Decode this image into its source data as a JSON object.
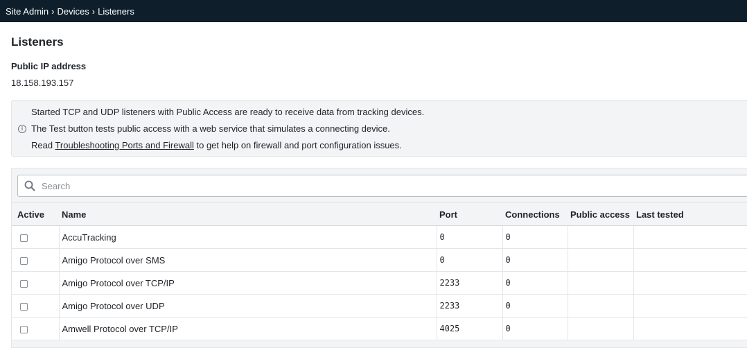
{
  "breadcrumb": {
    "items": [
      "Site Admin",
      "Devices",
      "Listeners"
    ],
    "separator": "›"
  },
  "page": {
    "title": "Listeners",
    "ip_label": "Public IP address",
    "ip_value": "18.158.193.157"
  },
  "info": {
    "line1": "Started TCP and UDP listeners with Public Access are ready to receive data from tracking devices.",
    "line2": "The Test button tests public access with a web service that simulates a connecting device.",
    "line3_prefix": "Read ",
    "line3_link": "Troubleshooting Ports and Firewall",
    "line3_suffix": " to get help on firewall and port configuration issues.",
    "icon": "info-circle-icon"
  },
  "search": {
    "placeholder": "Search",
    "value": "",
    "icon": "search-icon"
  },
  "table": {
    "headers": {
      "active": "Active",
      "name": "Name",
      "port": "Port",
      "connections": "Connections",
      "public_access": "Public access",
      "last_tested": "Last tested"
    },
    "rows": [
      {
        "active": false,
        "name": "AccuTracking",
        "port": "0",
        "connections": "0",
        "public_access": "",
        "last_tested": ""
      },
      {
        "active": false,
        "name": "Amigo Protocol over SMS",
        "port": "0",
        "connections": "0",
        "public_access": "",
        "last_tested": ""
      },
      {
        "active": false,
        "name": "Amigo Protocol over TCP/IP",
        "port": "2233",
        "connections": "0",
        "public_access": "",
        "last_tested": ""
      },
      {
        "active": false,
        "name": "Amigo Protocol over UDP",
        "port": "2233",
        "connections": "0",
        "public_access": "",
        "last_tested": ""
      },
      {
        "active": false,
        "name": "Amwell Protocol over TCP/IP",
        "port": "4025",
        "connections": "0",
        "public_access": "",
        "last_tested": ""
      }
    ]
  },
  "colors": {
    "topbar": "#0e1f2b",
    "panel": "#f3f4f6",
    "border": "#e3e5e8"
  }
}
